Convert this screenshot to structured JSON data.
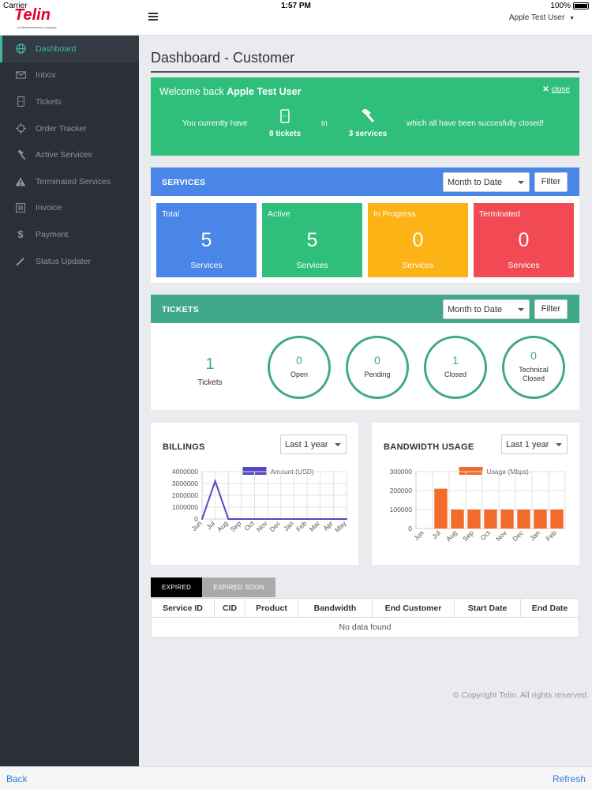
{
  "status_bar": {
    "carrier": "Carrier",
    "time": "1:57 PM",
    "battery": "100%"
  },
  "header": {
    "logo": "Telin",
    "logo_sub": "a telkomindonesia company",
    "user": "Apple Test User"
  },
  "sidebar": {
    "items": [
      {
        "label": "Dashboard",
        "icon": "globe-icon"
      },
      {
        "label": "Inbox",
        "icon": "envelope-icon"
      },
      {
        "label": "Tickets",
        "icon": "ticket-icon"
      },
      {
        "label": "Order Tracker",
        "icon": "crosshair-icon"
      },
      {
        "label": "Active Services",
        "icon": "gavel-icon"
      },
      {
        "label": "Terminated Services",
        "icon": "warning-icon"
      },
      {
        "label": "Invoice",
        "icon": "invoice-icon"
      },
      {
        "label": "Payment",
        "icon": "dollar-icon"
      },
      {
        "label": "Status Updater",
        "icon": "pencil-icon"
      }
    ]
  },
  "page": {
    "title": "Dashboard - Customer"
  },
  "welcome": {
    "prefix": "Welcome back",
    "user": "Apple Test User",
    "close": "close",
    "text_before": "You currently have",
    "tickets": "8 tickets",
    "text_in": "in",
    "services": "3 services",
    "text_after": "which all have been succesfully closed!",
    "color": "#2fbf7a"
  },
  "services": {
    "title": "SERVICES",
    "period": "Month to Date",
    "filter": "Filter",
    "color": "#4a86e8",
    "cards": [
      {
        "label": "Total",
        "value": "5",
        "sub": "Services",
        "color": "#4a86e8"
      },
      {
        "label": "Active",
        "value": "5",
        "sub": "Services",
        "color": "#2fbf7a"
      },
      {
        "label": "In Progress",
        "value": "0",
        "sub": "Services",
        "color": "#fbb316"
      },
      {
        "label": "Terminated",
        "value": "0",
        "sub": "Services",
        "color": "#f24a55"
      }
    ]
  },
  "tickets": {
    "title": "TICKETS",
    "period": "Month to Date",
    "filter": "Filter",
    "color": "#3fa98a",
    "total": {
      "value": "1",
      "label": "Tickets"
    },
    "circles": [
      {
        "value": "0",
        "label": "Open"
      },
      {
        "value": "0",
        "label": "Pending"
      },
      {
        "value": "1",
        "label": "Closed"
      },
      {
        "value": "0",
        "label": "Technical Closed"
      }
    ]
  },
  "billings": {
    "title": "BILLINGS",
    "period": "Last 1 year"
  },
  "bandwidth": {
    "title": "BANDWIDTH USAGE",
    "period": "Last 1 year"
  },
  "chart_data": [
    {
      "type": "line",
      "legend": "Amount (USD)",
      "color": "#5548c4",
      "categories": [
        "Jun",
        "Jul",
        "Aug",
        "Sep",
        "Oct",
        "Nov",
        "Dec",
        "Jan",
        "Feb",
        "Mar",
        "Apr",
        "May"
      ],
      "values": [
        0,
        3200000,
        0,
        0,
        0,
        0,
        0,
        0,
        0,
        0,
        0,
        0
      ],
      "ylim": [
        0,
        4000000
      ],
      "yticks": [
        "4000000",
        "3000000",
        "2000000",
        "1000000",
        "0"
      ],
      "grid": true
    },
    {
      "type": "bar",
      "legend": "Usage (Mbps)",
      "color": "#f26b2a",
      "categories": [
        "Jun",
        "Jul",
        "Aug",
        "Sep",
        "Oct",
        "Nov",
        "Dec",
        "Jan",
        "Feb"
      ],
      "values": [
        0,
        210000,
        100000,
        100000,
        100000,
        100000,
        100000,
        100000,
        100000
      ],
      "ylim": [
        0,
        300000
      ],
      "yticks": [
        "300000",
        "200000",
        "100000",
        "0"
      ],
      "grid": true
    }
  ],
  "table": {
    "tabs": [
      "EXPIRED",
      "EXPIRED SOON"
    ],
    "columns": [
      "Service ID",
      "CID",
      "Product",
      "Bandwidth",
      "End Customer",
      "Start Date",
      "End Date"
    ],
    "empty": "No data found"
  },
  "footer": {
    "copyright": "© Copyright Telin. All rights reserved."
  },
  "bottom_bar": {
    "back": "Back",
    "refresh": "Refresh"
  }
}
